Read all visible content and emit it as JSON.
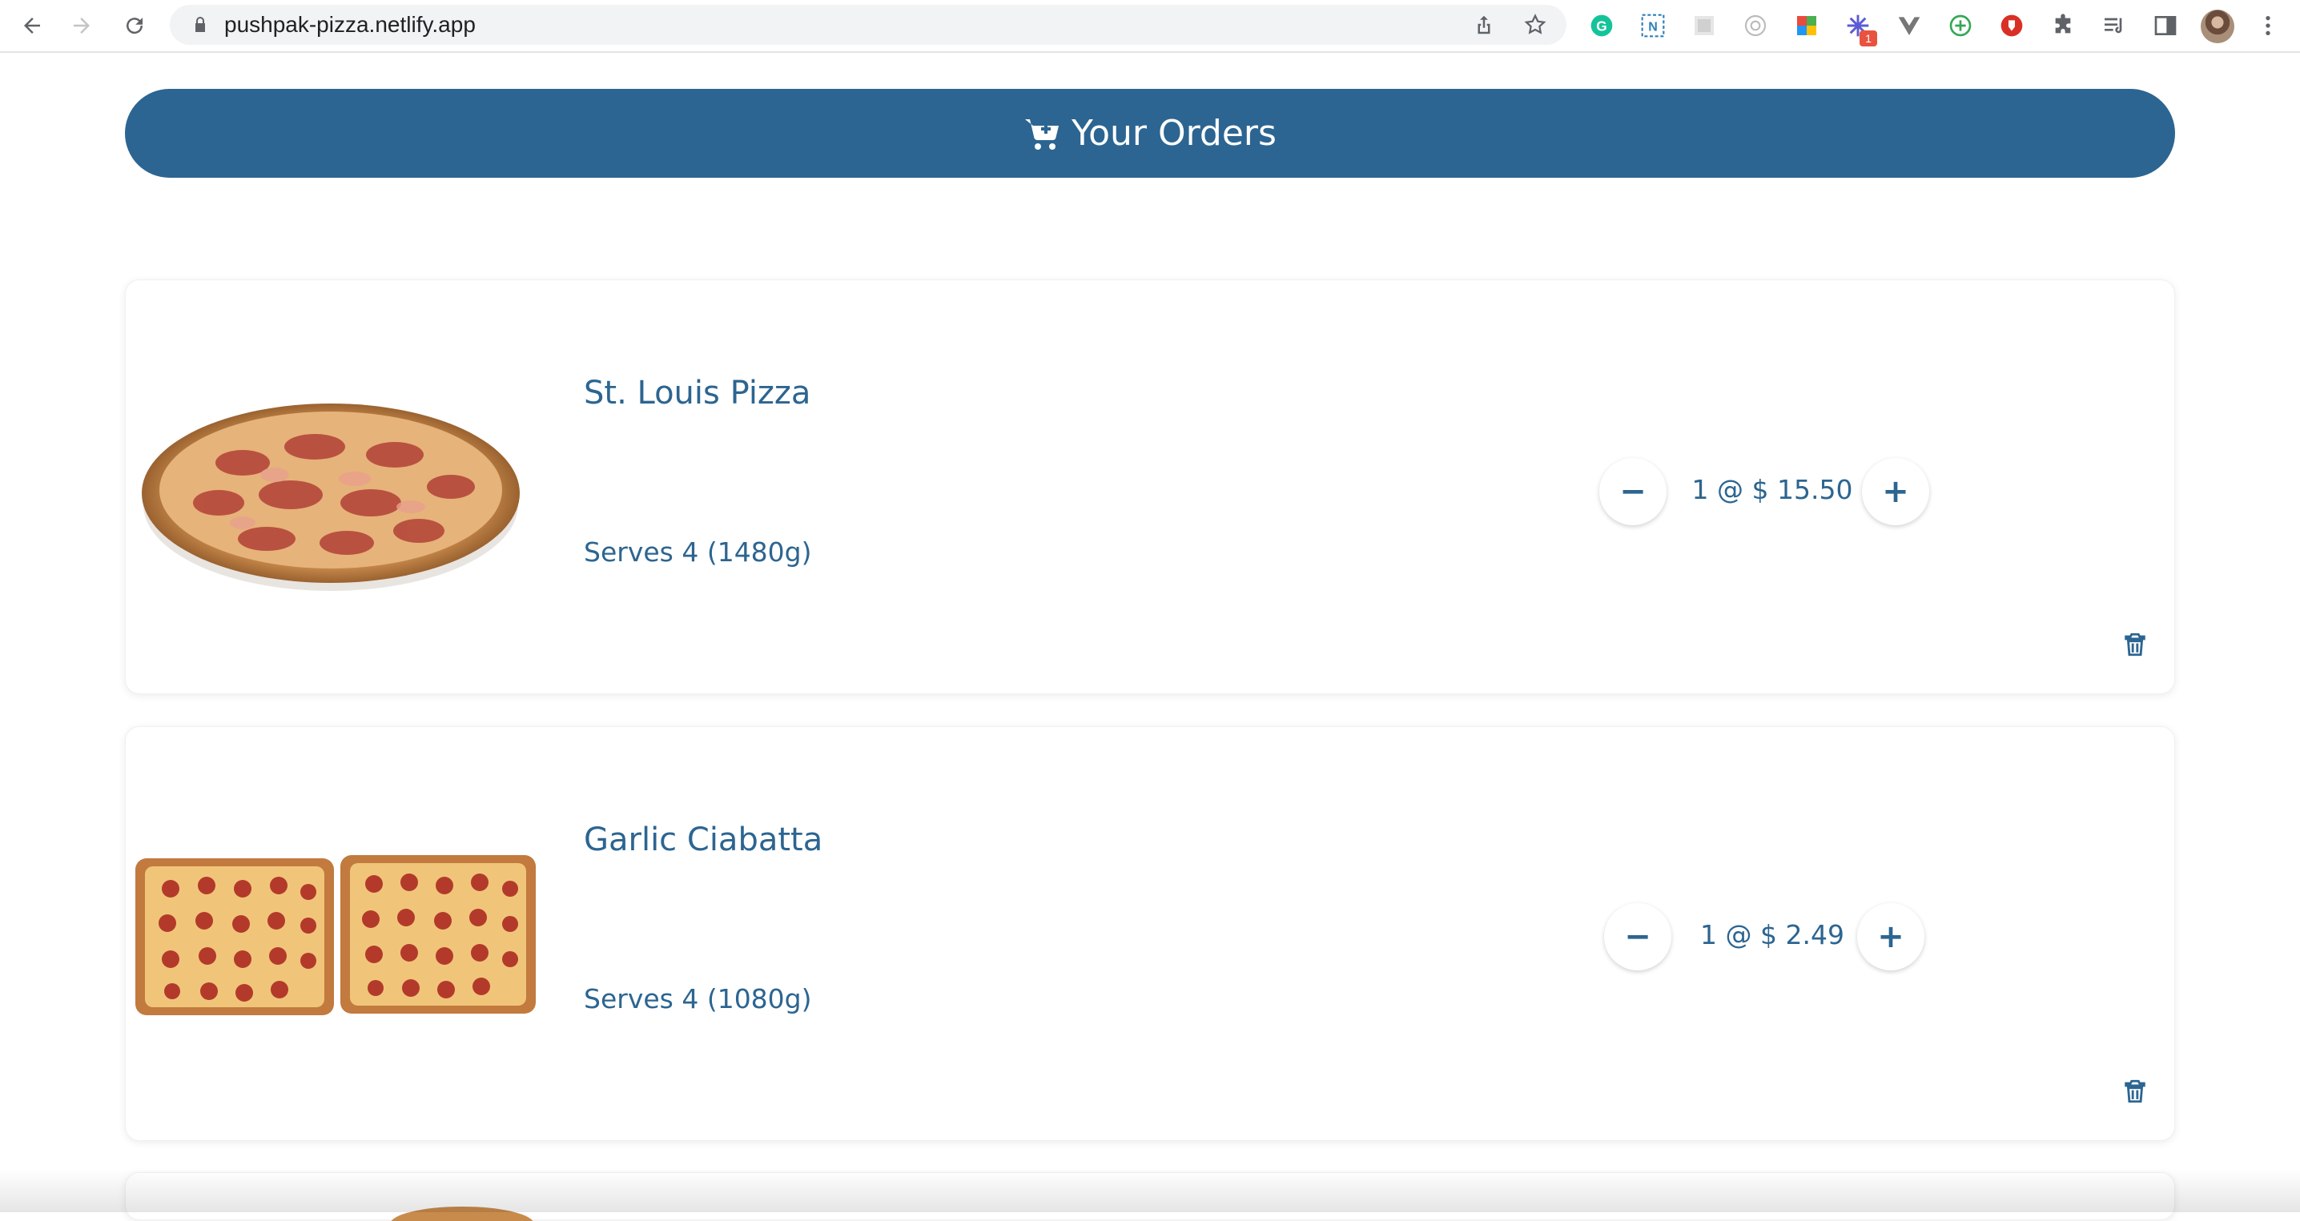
{
  "browser": {
    "url": "pushpak-pizza.netlify.app",
    "extension_badge": "1"
  },
  "page": {
    "header_title": "Your Orders",
    "orders": [
      {
        "name": "St. Louis Pizza",
        "serves": "Serves 4 (1480g)",
        "qty_text": "1 @ $ 15.50",
        "minus": "−",
        "plus": "+"
      },
      {
        "name": "Garlic Ciabatta",
        "serves": "Serves 4 (1080g)",
        "qty_text": "1 @ $ 2.49",
        "minus": "−",
        "plus": "+"
      }
    ]
  },
  "colors": {
    "brand": "#2c6591",
    "omnibox": "#f1f3f4"
  },
  "icons": [
    "back-icon",
    "forward-icon",
    "reload-icon",
    "lock-icon",
    "share-icon",
    "star-icon",
    "puzzle-icon",
    "cart-icon",
    "trash-icon"
  ]
}
